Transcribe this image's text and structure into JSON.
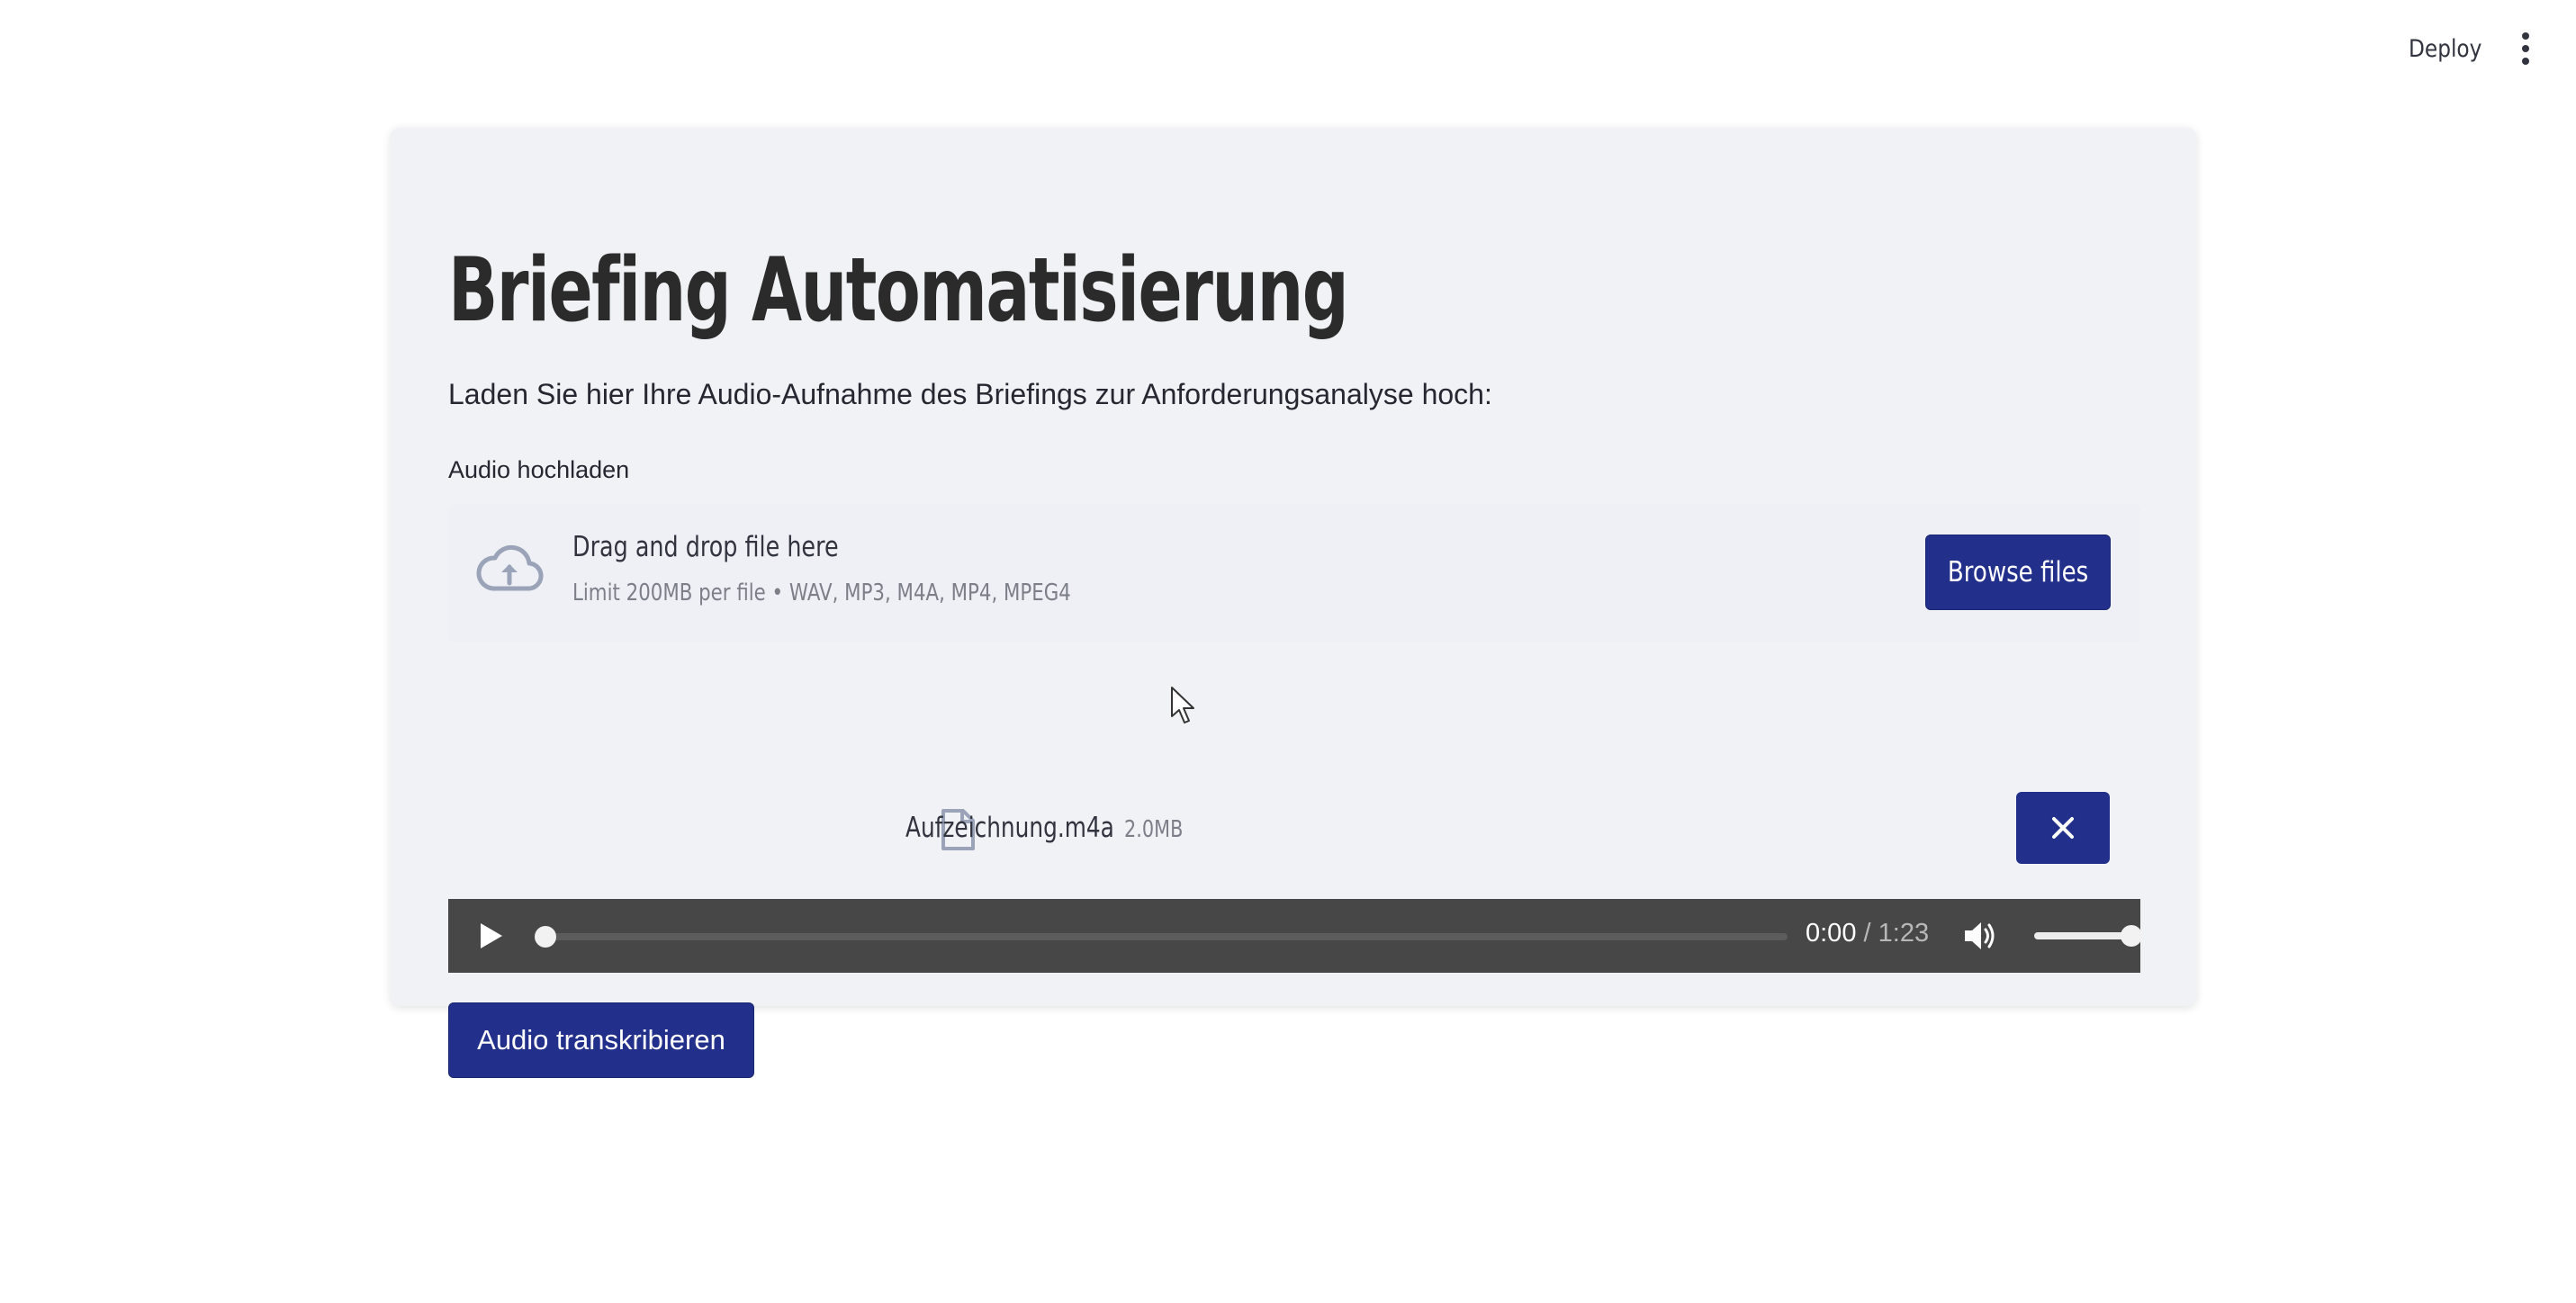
{
  "header": {
    "deploy_label": "Deploy",
    "menu_icon": "vertical-dots-icon"
  },
  "main": {
    "title": "Briefing Automatisierung",
    "subtitle": "Laden Sie hier Ihre Audio-Aufnahme des Briefings zur Anforderungsanalyse hoch:",
    "upload_label": "Audio hochladen"
  },
  "uploader": {
    "icon": "cloud-upload-icon",
    "dropzone_title": "Drag and drop file here",
    "dropzone_limit": "Limit 200MB per file • WAV, MP3, M4A, MP4, MPEG4",
    "browse_label": "Browse files"
  },
  "file": {
    "icon": "file-icon",
    "name": "Aufzeichnung.m4a",
    "size": "2.0MB",
    "remove_icon": "close-icon"
  },
  "player": {
    "current_time": "0:00",
    "separator": "/",
    "duration": "1:23",
    "progress": 0,
    "volume": 1.0,
    "play_icon": "play-icon",
    "volume_icon": "volume-icon"
  },
  "actions": {
    "transcribe_label": "Audio transkribieren"
  },
  "colors": {
    "primary": "#22308c",
    "card_background": "#f0f2f6",
    "player_background": "#474747"
  }
}
